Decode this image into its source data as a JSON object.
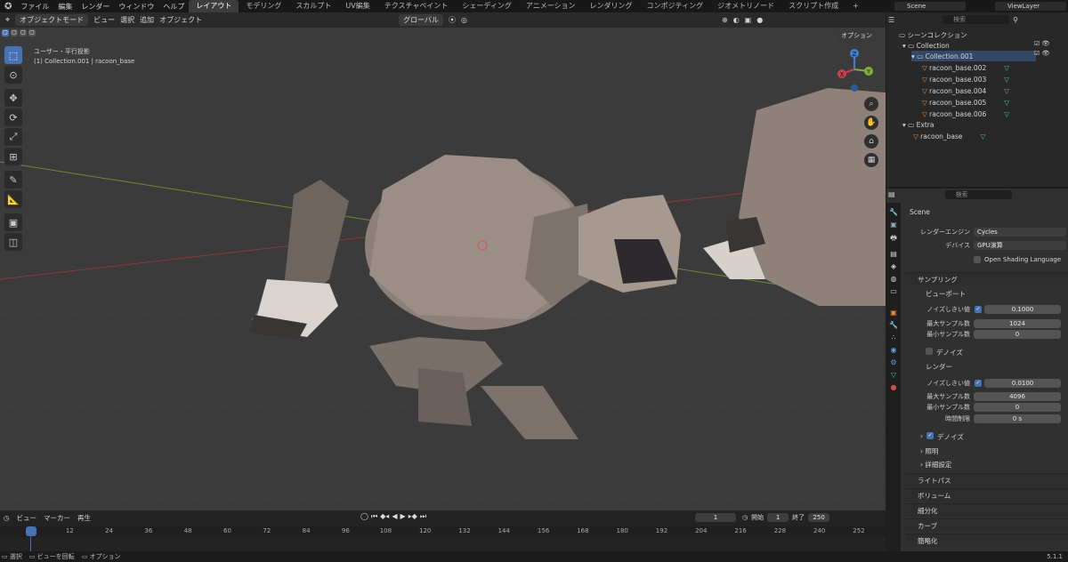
{
  "menu": {
    "items": [
      "ファイル",
      "編集",
      "レンダー",
      "ウィンドウ",
      "ヘルプ"
    ]
  },
  "workspaces": {
    "active": "レイアウト",
    "tabs": [
      "モデリング",
      "スカルプト",
      "UV編集",
      "テクスチャペイント",
      "シェーディング",
      "アニメーション",
      "レンダリング",
      "コンポジティング",
      "ジオメトリノード",
      "スクリプト作成"
    ],
    "add": "+"
  },
  "top_right": {
    "scene": "Scene",
    "view_layer": "ViewLayer"
  },
  "viewport": {
    "mode": "オブジェクトモード",
    "menus": [
      "ビュー",
      "選択",
      "追加",
      "オブジェクト"
    ],
    "transform": "グローバル",
    "options": "オプション",
    "overlay_view": "ユーザー・平行投影",
    "overlay_obj": "(1) Collection.001 | racoon_base",
    "gizmo": {
      "x": "X",
      "y": "Y",
      "z": "Z"
    }
  },
  "outliner": {
    "search_placeholder": "検索",
    "scene_collection": "シーンコレクション",
    "collection": "Collection",
    "collection001": "Collection.001",
    "objects": [
      "racoon_base.002",
      "racoon_base.003",
      "racoon_base.004",
      "racoon_base.005",
      "racoon_base.006"
    ],
    "extra": "Extra",
    "extra_obj": "racoon_base"
  },
  "properties": {
    "search_placeholder": "検索",
    "scene": "Scene",
    "render_engine_label": "レンダーエンジン",
    "render_engine": "Cycles",
    "device_label": "デバイス",
    "device": "GPU演算",
    "osl": "Open Shading Language",
    "sampling": "サンプリング",
    "viewport": "ビューポート",
    "noise_threshold_label": "ノイズしきい値",
    "vp_noise": "0.1000",
    "max_samples_label": "最大サンプル数",
    "vp_max": "1024",
    "min_samples_label": "最小サンプル数",
    "vp_min": "0",
    "denoise": "デノイズ",
    "render": "レンダー",
    "r_noise": "0.0100",
    "r_max": "4096",
    "r_min": "0",
    "time_limit_label": "時間制限",
    "r_time": "0 s",
    "lighting": "照明",
    "advanced": "詳細設定",
    "sections": [
      "ライトパス",
      "ボリューム",
      "細分化",
      "カーブ",
      "簡略化"
    ]
  },
  "timeline": {
    "menus": [
      "ビュー",
      "マーカー",
      "再生"
    ],
    "current_frame": "1",
    "start_label": "開始",
    "start": "1",
    "end_label": "終了",
    "end": "250",
    "ticks": [
      "1",
      "12",
      "24",
      "36",
      "48",
      "60",
      "72",
      "84",
      "96",
      "108",
      "120",
      "132",
      "144",
      "156",
      "168",
      "180",
      "192",
      "204",
      "216",
      "228",
      "240",
      "252"
    ]
  },
  "status": {
    "select": "選択",
    "rotate": "ビューを回転",
    "options": "オプション",
    "version": "5.1.1"
  },
  "colors": {
    "accent": "#4772b3",
    "viewport_bg": "#3b3b3b",
    "x_axis": "#c8434b",
    "y_axis": "#86b03b",
    "z_axis": "#3f7fd6"
  }
}
